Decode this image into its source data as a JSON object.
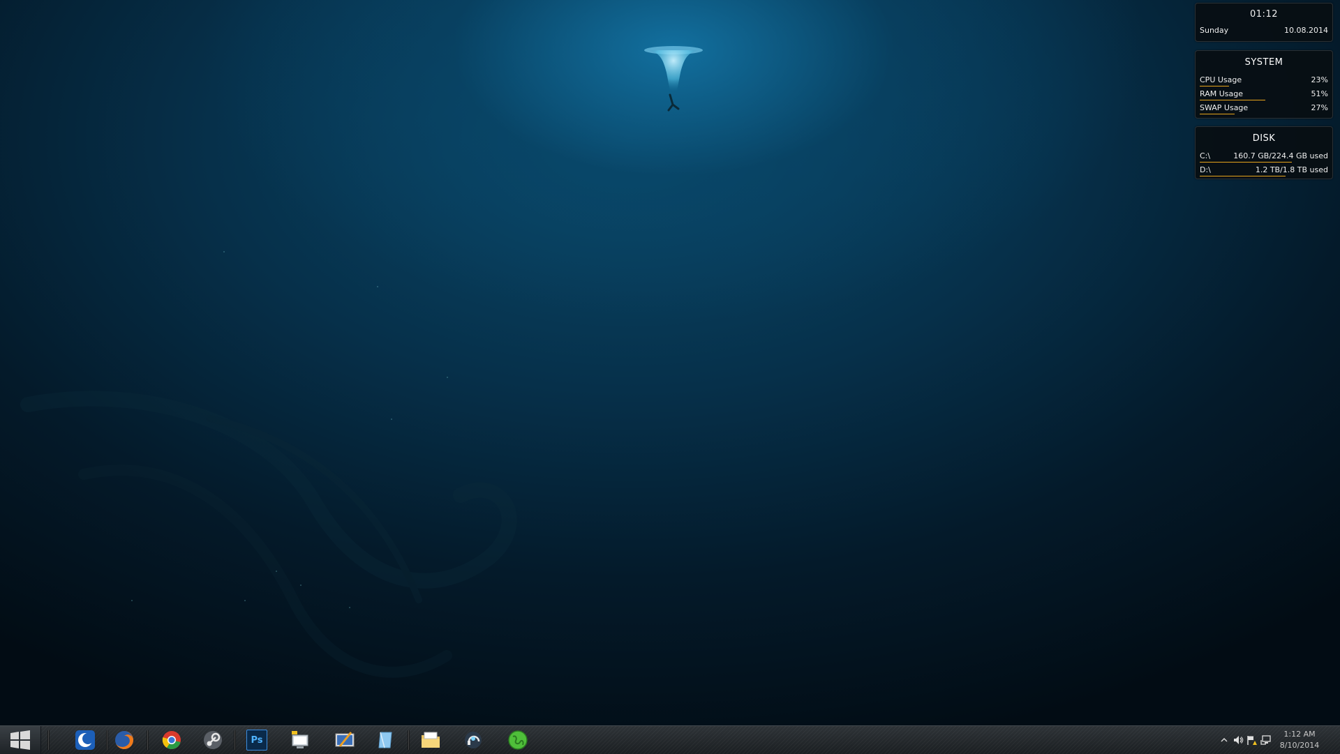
{
  "clock_widget": {
    "time": "01:12",
    "day": "Sunday",
    "date": "10.08.2014"
  },
  "system_widget": {
    "title": "SYSTEM",
    "rows": [
      {
        "label": "CPU Usage",
        "value": "23%",
        "level": 0.23
      },
      {
        "label": "RAM Usage",
        "value": "51%",
        "level": 0.51
      },
      {
        "label": "SWAP Usage",
        "value": "27%",
        "level": 0.27
      }
    ]
  },
  "disk_widget": {
    "title": "DISK",
    "rows": [
      {
        "label": "C:\\",
        "value": "160.7 GB/224.4 GB used",
        "level": 0.72
      },
      {
        "label": "D:\\",
        "value": "1.2 TB/1.8 TB used",
        "level": 0.67
      }
    ]
  },
  "taskbar": {
    "start_icon": "windows-logo-icon",
    "pinned": [
      {
        "icon": "crescent-app-icon"
      },
      {
        "icon": "firefox-icon"
      },
      {
        "icon": "chrome-icon"
      },
      {
        "icon": "steam-icon"
      },
      {
        "icon": "photoshop-icon"
      },
      {
        "icon": "notepad-monitor-icon"
      },
      {
        "icon": "pen-tablet-icon"
      },
      {
        "icon": "paper-icon"
      },
      {
        "icon": "file-explorer-icon"
      },
      {
        "icon": "headset-voice-icon"
      },
      {
        "icon": "green-globe-icon"
      }
    ],
    "photoshop_label": "Ps",
    "tray_clock": {
      "time": "1:12 AM",
      "date": "8/10/2014"
    }
  },
  "colors": {
    "accent_bar": "#e8a51b",
    "widget_bg": "#080e12",
    "taskbar_bg": "#1b1f22"
  }
}
